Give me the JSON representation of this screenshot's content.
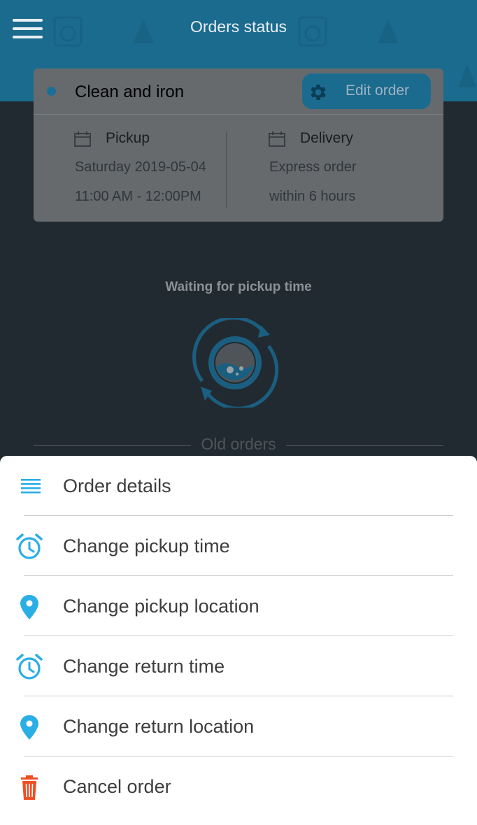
{
  "header": {
    "title": "Orders status",
    "color": "#1b6b8f"
  },
  "order": {
    "service": "Clean and iron",
    "edit_label": "Edit order",
    "pickup": {
      "label": "Pickup",
      "date": "Saturday 2019-05-04",
      "time": "11:00 AM - 12:00PM"
    },
    "delivery": {
      "label": "Delivery",
      "line1": "Express order",
      "line2": "within 6 hours"
    }
  },
  "status": {
    "text": "Waiting for pickup time",
    "icon": "washing-machine-refresh-icon"
  },
  "old_orders_label": "Old orders",
  "menu": {
    "accent": "#2aaee6",
    "danger": "#f04e23",
    "items": [
      {
        "label": "Order details",
        "icon": "list-icon"
      },
      {
        "label": "Change pickup time",
        "icon": "alarm-clock-icon"
      },
      {
        "label": "Change pickup location",
        "icon": "location-pin-icon"
      },
      {
        "label": "Change return time",
        "icon": "alarm-clock-icon"
      },
      {
        "label": "Change return location",
        "icon": "location-pin-icon"
      },
      {
        "label": "Cancel order",
        "icon": "trash-icon"
      }
    ]
  }
}
